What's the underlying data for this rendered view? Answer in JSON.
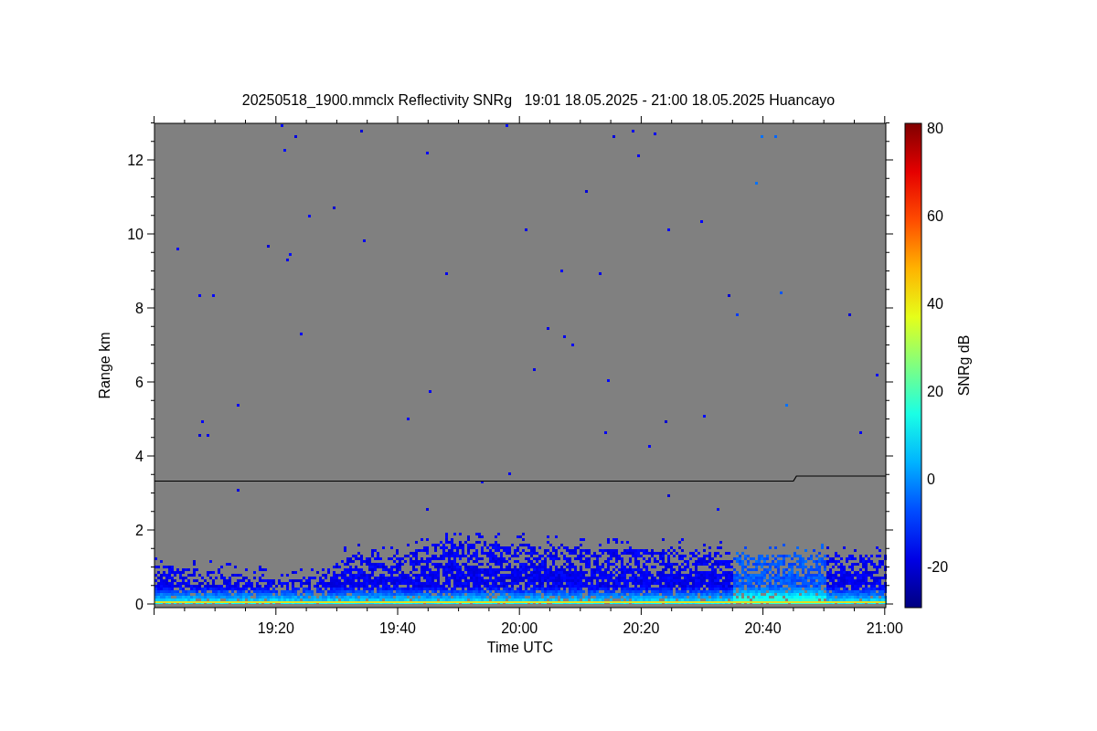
{
  "title": "20250518_1900.mmclx Reflectivity SNRg   19:01 18.05.2025 - 21:00 18.05.2025 Huancayo",
  "y_axis": {
    "label": "Range km",
    "ticks": [
      "12",
      "10",
      "8",
      "6",
      "4",
      "2",
      "0"
    ]
  },
  "x_axis": {
    "label": "Time UTC",
    "ticks": [
      "19:20",
      "19:40",
      "20:00",
      "20:20",
      "20:40",
      "21:00"
    ]
  },
  "colorbar": {
    "label": "SNRg dB",
    "ticks": [
      "80",
      "60",
      "40",
      "20",
      "0",
      "-20"
    ]
  }
}
